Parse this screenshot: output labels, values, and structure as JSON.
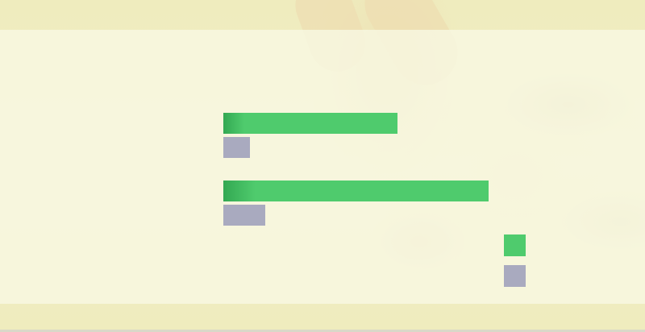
{
  "chart_data": {
    "type": "bar",
    "orientation": "horizontal",
    "categories": [
      "",
      ""
    ],
    "series": [
      {
        "color": "#4fcb6d",
        "values": [
          216,
          329
        ]
      },
      {
        "color": "#a9aabf",
        "values": [
          33,
          52
        ]
      }
    ],
    "xlim": [
      0,
      400
    ],
    "grid": false,
    "legend": "right"
  }
}
